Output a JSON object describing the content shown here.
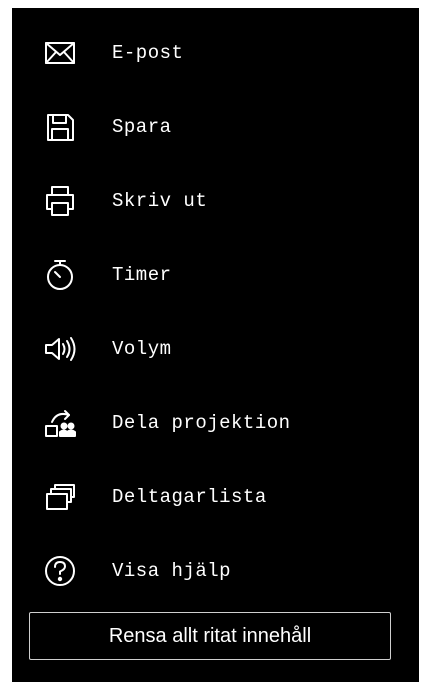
{
  "menu": {
    "items": [
      {
        "label": "E-post",
        "icon": "mail-icon"
      },
      {
        "label": "Spara",
        "icon": "save-icon"
      },
      {
        "label": "Skriv ut",
        "icon": "printer-icon"
      },
      {
        "label": "Timer",
        "icon": "stopwatch-icon"
      },
      {
        "label": "Volym",
        "icon": "speaker-icon"
      },
      {
        "label": "Dela projektion",
        "icon": "share-projection-icon"
      },
      {
        "label": "Deltagarlista",
        "icon": "participants-list-icon"
      },
      {
        "label": "Visa hjälp",
        "icon": "help-icon"
      }
    ]
  },
  "actions": {
    "clear_label": "Rensa allt ritat innehåll"
  },
  "colors": {
    "panel_background": "#000000",
    "text": "#ffffff",
    "button_border": "#cfcfcf"
  }
}
